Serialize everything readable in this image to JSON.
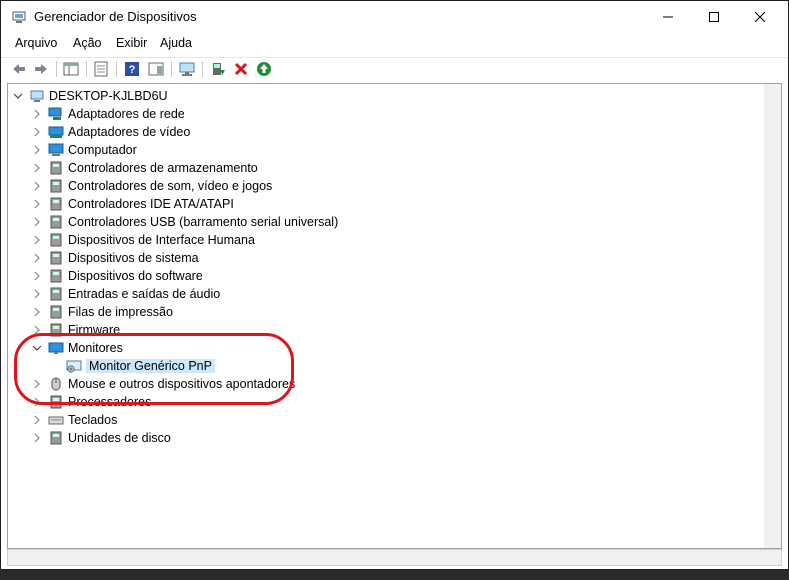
{
  "window": {
    "title": "Gerenciador de Dispositivos",
    "controls": [
      "minimize",
      "maximize",
      "close"
    ]
  },
  "menu": [
    "Arquivo",
    "Ação",
    "Exibir",
    "Ajuda"
  ],
  "toolbar": {
    "icons": [
      "back-arrow-icon",
      "forward-arrow-icon",
      "show-hide-console-tree-icon",
      "properties-icon",
      "help-icon",
      "action-pane-icon",
      "scan-hardware-icon",
      "update-driver-icon",
      "uninstall-device-icon",
      "enable-device-icon"
    ],
    "colors": {
      "uninstall": "#d9141e",
      "enable": "#1e8f2f"
    }
  },
  "tree": {
    "root": "DESKTOP-KJLBD6U",
    "items": [
      {
        "label": "Adaptadores de rede",
        "icon": "network-adapter-icon"
      },
      {
        "label": "Adaptadores de vídeo",
        "icon": "display-adapter-icon"
      },
      {
        "label": "Computador",
        "icon": "computer-icon"
      },
      {
        "label": "Controladores de armazenamento",
        "icon": "storage-controller-icon"
      },
      {
        "label": "Controladores de som, vídeo e jogos",
        "icon": "sound-icon"
      },
      {
        "label": "Controladores IDE ATA/ATAPI",
        "icon": "ide-icon"
      },
      {
        "label": "Controladores USB (barramento serial universal)",
        "icon": "usb-icon"
      },
      {
        "label": "Dispositivos de Interface Humana",
        "icon": "hid-icon"
      },
      {
        "label": "Dispositivos de sistema",
        "icon": "system-device-icon"
      },
      {
        "label": "Dispositivos do software",
        "icon": "software-device-icon"
      },
      {
        "label": "Entradas e saídas de áudio",
        "icon": "audio-io-icon"
      },
      {
        "label": "Filas de impressão",
        "icon": "print-queue-icon"
      },
      {
        "label": "Firmware",
        "icon": "firmware-icon"
      },
      {
        "label": "Monitores",
        "icon": "monitor-icon",
        "expanded": true,
        "children": [
          {
            "label": "Monitor Genérico PnP",
            "icon": "generic-monitor-icon",
            "selected": true
          }
        ]
      },
      {
        "label": "Mouse e outros dispositivos apontadores",
        "icon": "mouse-icon"
      },
      {
        "label": "Processadores",
        "icon": "processor-icon"
      },
      {
        "label": "Teclados",
        "icon": "keyboard-icon"
      },
      {
        "label": "Unidades de disco",
        "icon": "disk-drive-icon"
      }
    ]
  },
  "annotation_color": "#e0141e"
}
